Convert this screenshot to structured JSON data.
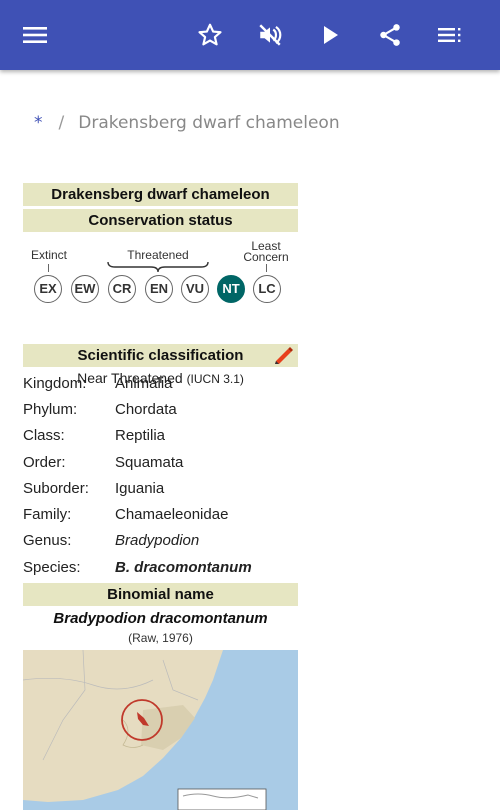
{
  "toolbar": {
    "menu_icon": "menu-icon",
    "favorite_icon": "star-outline-icon",
    "mute_icon": "volume-off-icon",
    "play_icon": "play-icon",
    "share_icon": "share-icon",
    "contents_icon": "toc-list-icon",
    "background_color": "#3f51b5"
  },
  "breadcrumb": {
    "home": "*",
    "separator": "/",
    "current": "Drakensberg dwarf chameleon"
  },
  "infobox": {
    "title": "Drakensberg dwarf chameleon",
    "conservation_header": "Conservation status",
    "status_groups": {
      "extinct": "Extinct",
      "threatened": "Threatened",
      "least_concern_line1": "Least",
      "least_concern_line2": "Concern"
    },
    "status_codes": [
      "EX",
      "EW",
      "CR",
      "EN",
      "VU",
      "NT",
      "LC"
    ],
    "selected_status": "NT",
    "selected_color": "#006666",
    "status_text": "Near Threatened",
    "status_source": "(IUCN 3.1)",
    "classification_header": "Scientific classification",
    "edit_icon": "pencil-icon",
    "classification": [
      {
        "rank": "Kingdom:",
        "value": "Animalia"
      },
      {
        "rank": "Phylum:",
        "value": "Chordata"
      },
      {
        "rank": "Class:",
        "value": "Reptilia"
      },
      {
        "rank": "Order:",
        "value": "Squamata"
      },
      {
        "rank": "Suborder:",
        "value": "Iguania"
      },
      {
        "rank": "Family:",
        "value": "Chamaeleonidae"
      },
      {
        "rank": "Genus:",
        "value": "Bradypodion"
      },
      {
        "rank": "Species:",
        "value": "B. dracomontanum"
      }
    ],
    "binomial_header": "Binomial name",
    "binomial": "Bradypodion dracomontanum",
    "authority": "(Raw, 1976)",
    "header_color": "#e6e6c2"
  }
}
